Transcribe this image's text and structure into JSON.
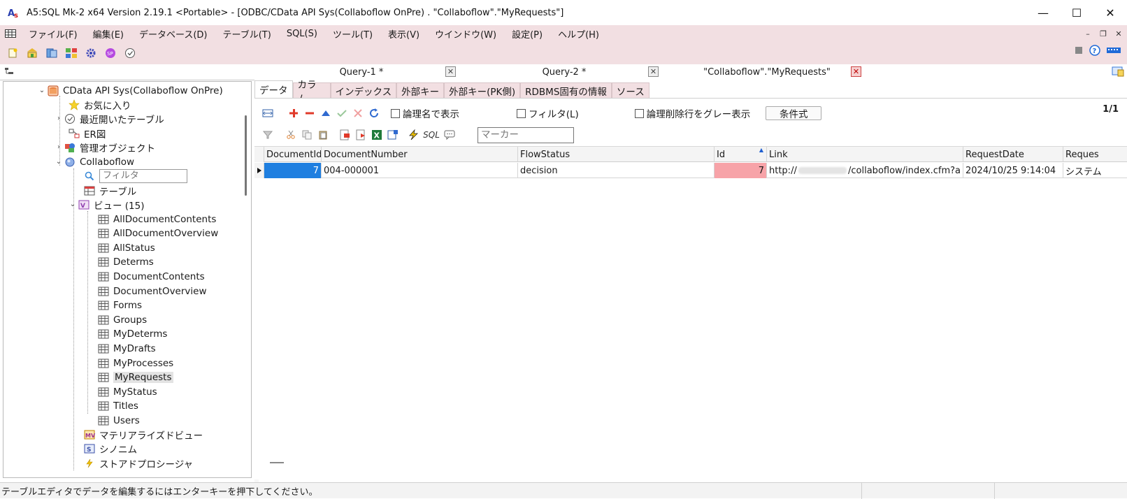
{
  "window": {
    "title": "A5:SQL Mk-2 x64 Version 2.19.1 <Portable> - [ODBC/CData API Sys(Collaboflow OnPre) . \"Collaboflow\".\"MyRequests\"]",
    "minimize": "—",
    "maximize": "☐",
    "close": "✕"
  },
  "menu": {
    "items": [
      "ファイル(F)",
      "編集(E)",
      "データベース(D)",
      "テーブル(T)",
      "SQL(S)",
      "ツール(T)",
      "表示(V)",
      "ウインドウ(W)",
      "設定(P)",
      "ヘルプ(H)"
    ],
    "mdi_min": "–",
    "mdi_restore": "❐",
    "mdi_close": "✕"
  },
  "doc_tabs": [
    {
      "label": "Query-1 *",
      "close": "✕"
    },
    {
      "label": "Query-2 *",
      "close": "✕"
    },
    {
      "label": "\"Collaboflow\".\"MyRequests\"",
      "close": "✕"
    }
  ],
  "tree": {
    "connection": "CData API Sys(Collaboflow OnPre)",
    "favorites": "お気に入り",
    "recent": "最近開いたテーブル",
    "er": "ER図",
    "objects": "管理オブジェクト",
    "schema": "Collaboflow",
    "filter_placeholder": "フィルタ",
    "tables": "テーブル",
    "views": "ビュー (15)",
    "view_items": [
      "AllDocumentContents",
      "AllDocumentOverview",
      "AllStatus",
      "Determs",
      "DocumentContents",
      "DocumentOverview",
      "Forms",
      "Groups",
      "MyDeterms",
      "MyDrafts",
      "MyProcesses",
      "MyRequests",
      "MyStatus",
      "Titles",
      "Users"
    ],
    "materialized": "マテリアライズドビュー",
    "synonym": "シノニム",
    "stored_proc": "ストアドプロシージャ"
  },
  "inner_tabs": [
    "データ",
    "カラム",
    "インデックス",
    "外部キー",
    "外部キー(PK側)",
    "RDBMS固有の情報",
    "ソース"
  ],
  "data_view": {
    "chk_logical": "論理名で表示",
    "chk_filter": "フィルタ(L)",
    "chk_gray": "論理削除行をグレー表示",
    "btn_condition": "条件式",
    "page": "1/1",
    "marker_placeholder": "マーカー",
    "sql_label": "SQL"
  },
  "grid": {
    "columns": [
      "DocumentId",
      "DocumentNumber",
      "FlowStatus",
      "Id",
      "Link",
      "RequestDate",
      "Reques"
    ],
    "row": {
      "DocumentId": "7",
      "DocumentNumber": "004-000001",
      "FlowStatus": "decision",
      "Id": "7",
      "Link_prefix": "http://",
      "Link_suffix": "/collaboflow/index.cfm?a",
      "RequestDate": "2024/10/25 9:14:04",
      "Requester": "システム"
    }
  },
  "status": {
    "text": "テーブルエディタでデータを編集するにはエンターキーを押下してください。"
  },
  "colors": {
    "pink_bar": "#f2dfe2",
    "selected_cell": "#1f7fe0",
    "highlight_cell": "#f7a3a8"
  }
}
